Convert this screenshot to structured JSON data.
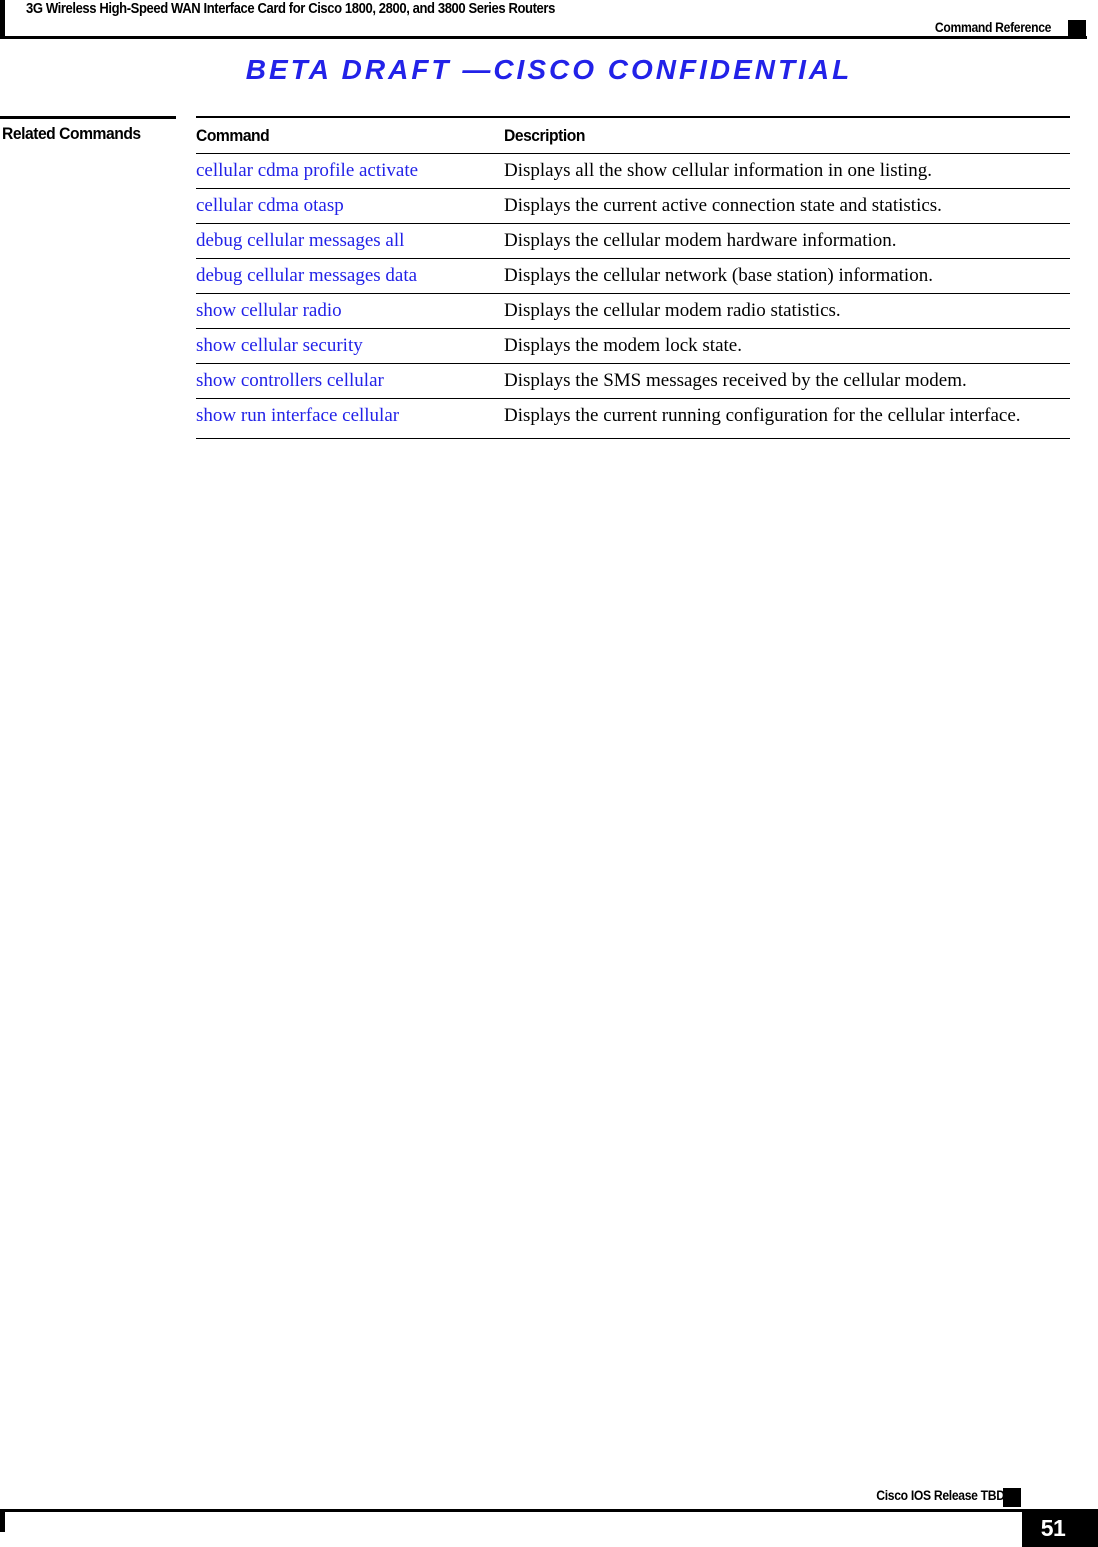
{
  "header": {
    "running_title": "3G Wireless High-Speed WAN Interface Card for Cisco 1800, 2800, and 3800 Series Routers",
    "chapter_title": "Command Reference"
  },
  "watermark": {
    "text": "BETA DRAFT —CISCO CONFIDENTIAL",
    "color": "#2222e8"
  },
  "section": {
    "side_label": "Related Commands"
  },
  "table": {
    "headers": {
      "command": "Command",
      "description": "Description"
    },
    "link_color": "#2222e8",
    "rows": [
      {
        "command": "cellular cdma profile activate",
        "description": "Displays all the show cellular information in one listing."
      },
      {
        "command": "cellular cdma otasp",
        "description": "Displays the current active connection state and statistics."
      },
      {
        "command": "debug cellular messages all",
        "description": "Displays the cellular modem hardware information."
      },
      {
        "command": "debug cellular messages data",
        "description": "Displays the cellular network (base station) information."
      },
      {
        "command": "show cellular radio",
        "description": "Displays the cellular modem radio statistics."
      },
      {
        "command": "show cellular security",
        "description": "Displays the modem lock state."
      },
      {
        "command": "show controllers cellular",
        "description": "Displays the SMS messages received by the cellular modem."
      },
      {
        "command": "show run interface cellular",
        "description": "Displays the current running configuration for the cellular interface."
      }
    ]
  },
  "footer": {
    "release": "Cisco IOS Release TBD",
    "page_number": "51"
  }
}
